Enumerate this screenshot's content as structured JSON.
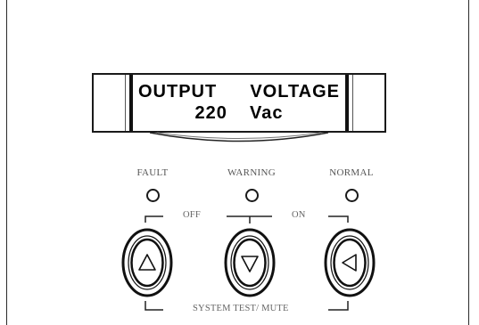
{
  "display": {
    "line1": "OUTPUT  VOLTAGE",
    "line2": "220  Vac"
  },
  "indicators": [
    {
      "label": "FAULT"
    },
    {
      "label": "WARNING"
    },
    {
      "label": "NORMAL"
    }
  ],
  "bracket_labels": {
    "off": "OFF",
    "on": "ON",
    "system_test_mute": "SYSTEM TEST/ MUTE"
  },
  "buttons": [
    {
      "icon": "triangle-up-icon"
    },
    {
      "icon": "triangle-down-icon"
    },
    {
      "icon": "triangle-left-icon"
    }
  ]
}
